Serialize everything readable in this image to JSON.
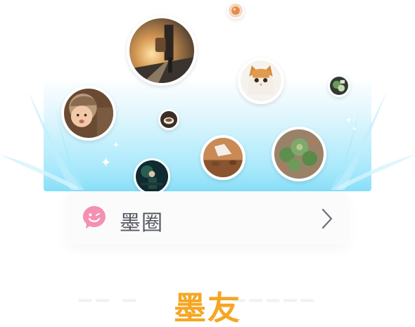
{
  "card": {
    "label": "墨圈",
    "icon": "smiley-speech-bubble-icon",
    "chevron": "chevron-right-icon"
  },
  "bottom": {
    "title": "墨友"
  },
  "colors": {
    "accent_orange": "#f5a623",
    "burst_blue": "#88def8",
    "icon_pink": "#f490b1",
    "label_gray": "#555a60"
  },
  "photos": [
    "traveler-road-photo",
    "orange-ball-photo",
    "kitten-photo",
    "plant-photo-small",
    "baby-photo",
    "coffee-cup-photo",
    "tea-set-photo",
    "succulents-photo",
    "concert-photo"
  ]
}
